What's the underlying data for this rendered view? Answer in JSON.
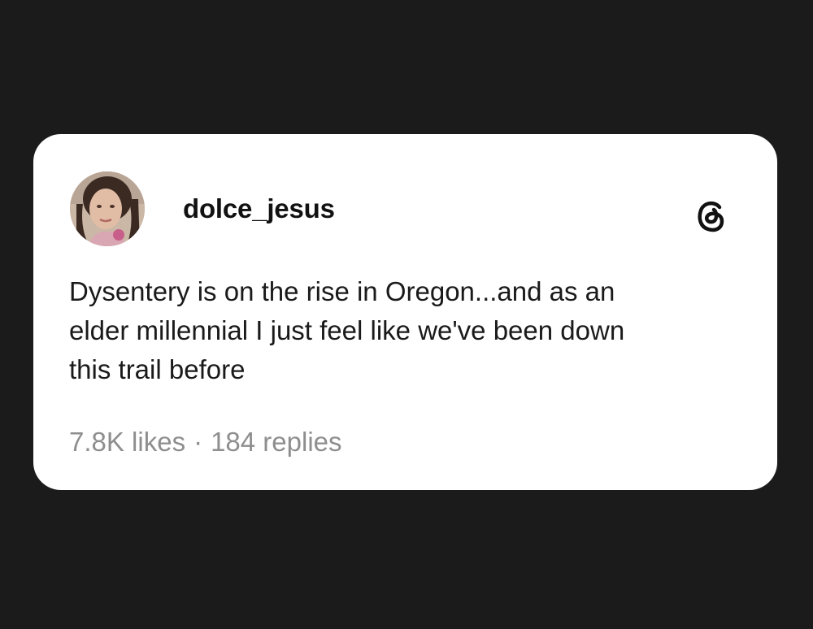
{
  "post": {
    "username": "dolce_jesus",
    "avatar_icon": "profile-photo",
    "platform_icon": "threads-logo-icon",
    "text": "Dysentery is on the rise in Oregon...and as an\nelder millennial I just feel like we've been down\nthis trail before",
    "likes": "7.8K likes",
    "separator": "·",
    "replies": "184 replies"
  },
  "colors": {
    "background": "#1b1b1b",
    "card": "#ffffff",
    "text": "#1a1a1a",
    "muted": "#8e8e8e"
  }
}
